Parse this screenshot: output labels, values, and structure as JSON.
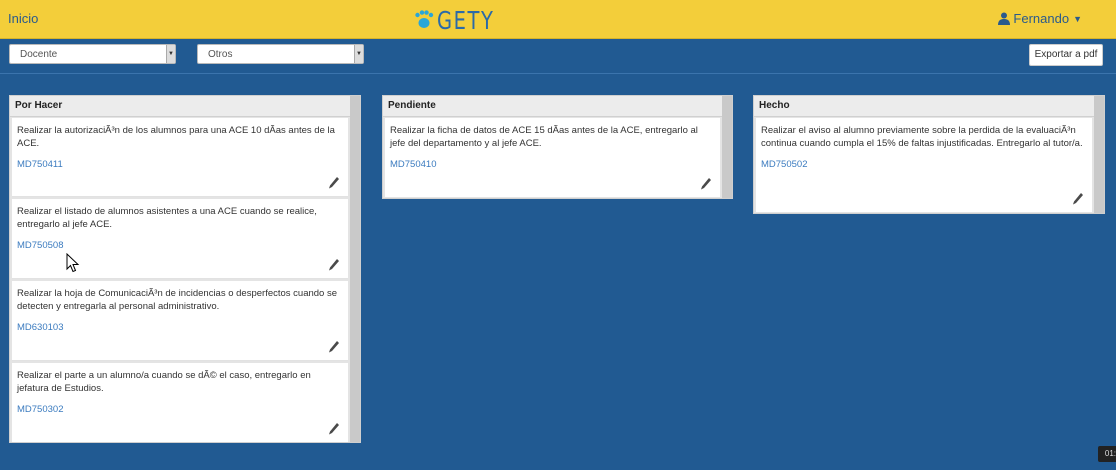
{
  "header": {
    "home_label": "Inicio",
    "logo_text": "GETY",
    "user_name": "Fernando"
  },
  "filters": {
    "role_select": "Docente",
    "category_select": "Otros",
    "export_label": "Exportar a pdf"
  },
  "columns": [
    {
      "title": "Por Hacer",
      "cards": [
        {
          "text": "Realizar la autorizaciÃ³n de los alumnos para una ACE 10 dÃ­as antes de la ACE.",
          "code": "MD750411"
        },
        {
          "text": "Realizar el listado de alumnos asistentes a una ACE cuando se realice, entregarlo al jefe ACE.",
          "code": "MD750508"
        },
        {
          "text": "Realizar la hoja de ComunicaciÃ³n de incidencias o desperfectos cuando se detecten y entregarla al personal administrativo.",
          "code": "MD630103"
        },
        {
          "text": "Realizar el parte a un alumno/a cuando se dÃ© el caso, entregarlo en jefatura de Estudios.",
          "code": "MD750302"
        }
      ]
    },
    {
      "title": "Pendiente",
      "cards": [
        {
          "text": "Realizar la ficha de datos de ACE 15 dÃ­as antes de la ACE, entregarlo al jefe del departamento y al jefe ACE.",
          "code": "MD750410"
        }
      ]
    },
    {
      "title": "Hecho",
      "cards": [
        {
          "text": "Realizar el aviso al alumno previamente sobre la perdida de la evaluaciÃ³n continua cuando cumpla el 15% de faltas injustificadas. Entregarlo al tutor/a.",
          "code": "MD750502"
        }
      ]
    }
  ],
  "overlay": {
    "time_badge": "01:"
  },
  "colors": {
    "topbar": "#f3ce3a",
    "background": "#215a92",
    "link": "#3b7bbf"
  }
}
